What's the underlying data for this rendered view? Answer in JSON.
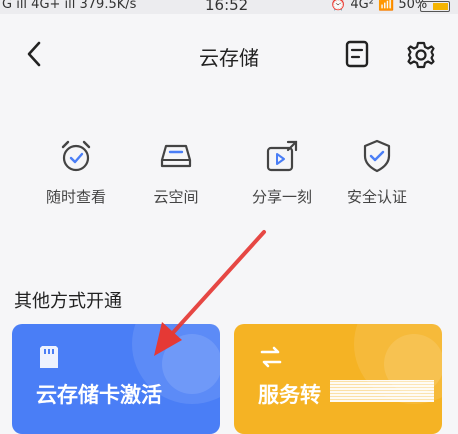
{
  "status_bar": {
    "left": "G ıll 4G+ ıll 379.5K/s",
    "time": "16:52",
    "right": "⏰ 4G² 📶 50%"
  },
  "header": {
    "title": "云存储"
  },
  "features": [
    {
      "label": "随时查看",
      "icon": "alarm-clock-check-icon"
    },
    {
      "label": "云空间",
      "icon": "cloud-drive-icon"
    },
    {
      "label": "分享一刻",
      "icon": "share-video-icon"
    },
    {
      "label": "安全认证",
      "icon": "shield-check-icon"
    }
  ],
  "section": {
    "title": "其他方式开通"
  },
  "cards": [
    {
      "label": "云存储卡激活",
      "icon": "sd-card-icon",
      "color": "#4a7ef6"
    },
    {
      "label": "服务转",
      "icon": "transfer-icon",
      "color": "#f5b324"
    }
  ],
  "colors": {
    "accent": "#4a7ef6",
    "secondary": "#f5b324",
    "arrow": "#e53935"
  }
}
